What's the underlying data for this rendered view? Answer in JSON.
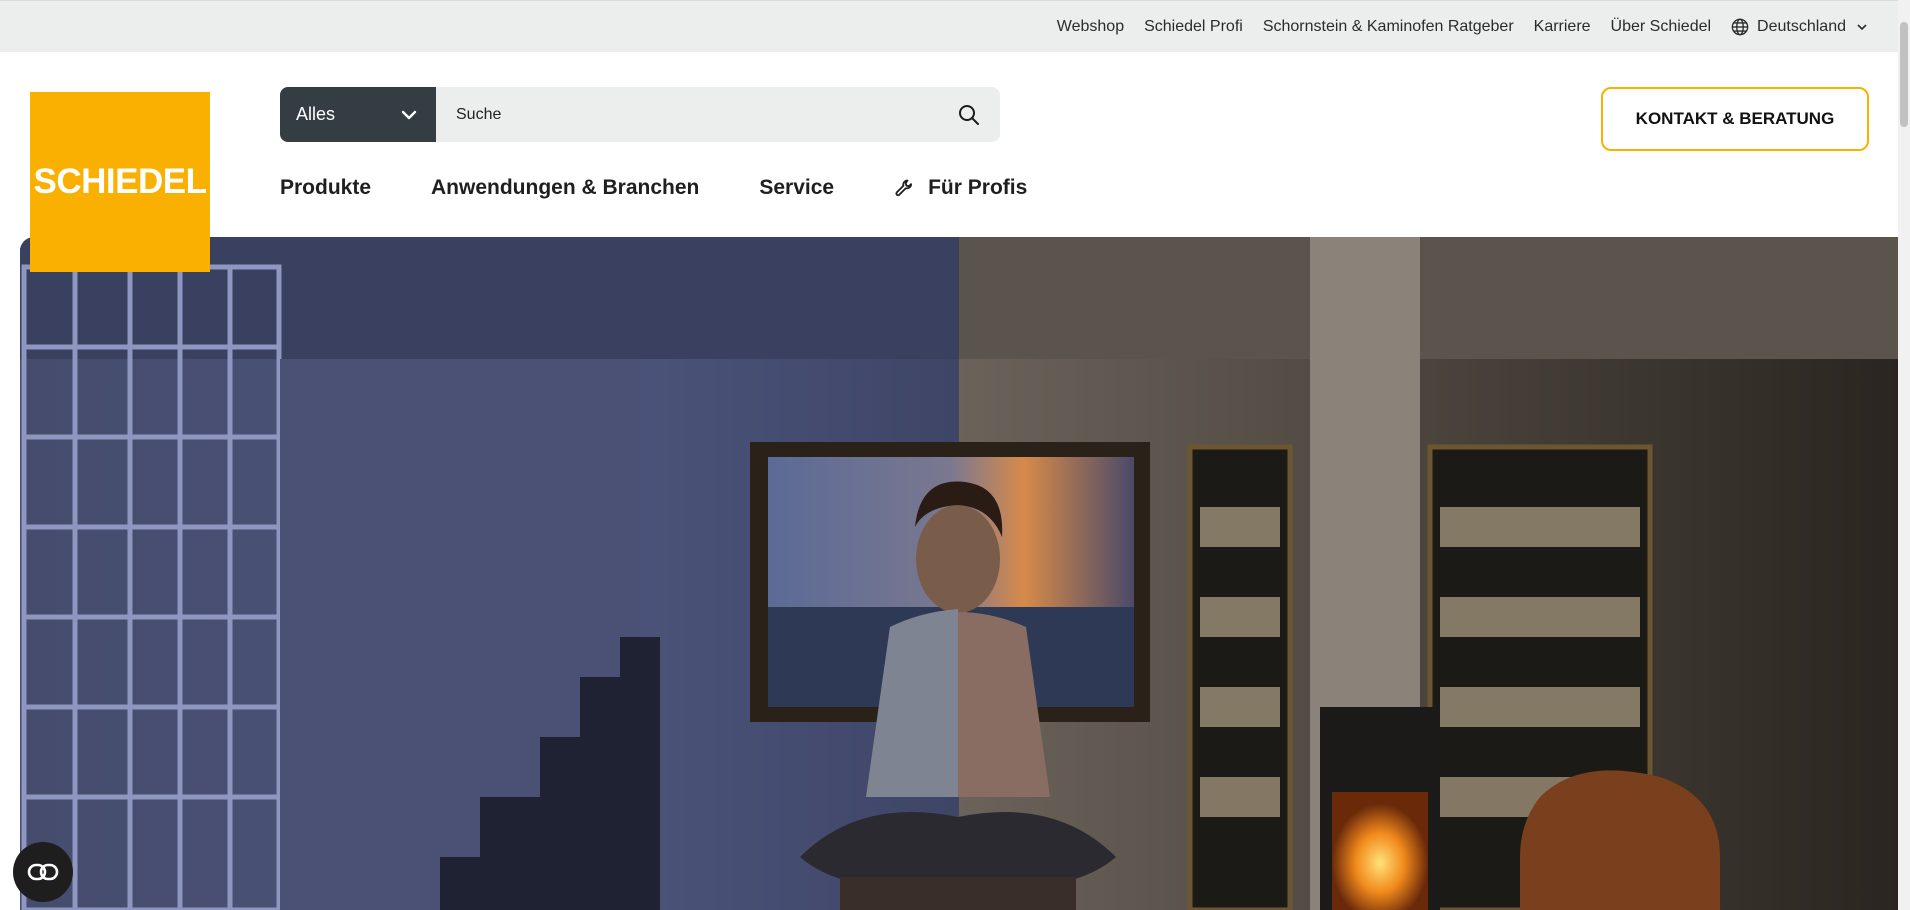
{
  "topbar": {
    "links": [
      "Webshop",
      "Schiedel Profi",
      "Schornstein & Kaminofen Ratgeber",
      "Karriere",
      "Über Schiedel"
    ],
    "language": "Deutschland"
  },
  "logo": {
    "text": "SCHIEDEL"
  },
  "search": {
    "category": "Alles",
    "placeholder": "Suche"
  },
  "contact_button": "KONTAKT & BERATUNG",
  "nav": {
    "products": "Produkte",
    "applications": "Anwendungen & Branchen",
    "service": "Service",
    "profis": "Für Profis"
  },
  "colors": {
    "brand": "#f9b000",
    "dark": "#343d42",
    "topbar_bg": "#eceeed"
  }
}
